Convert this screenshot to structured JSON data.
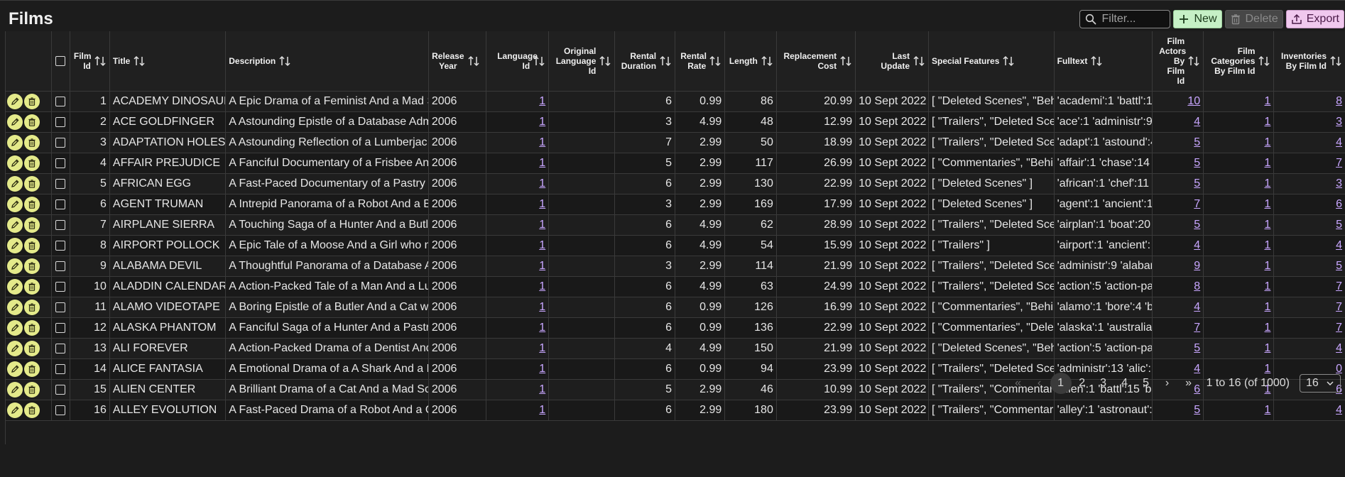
{
  "title": "Films",
  "toolbar": {
    "filter_placeholder": "Filter...",
    "new_label": "New",
    "delete_label": "Delete",
    "export_label": "Export"
  },
  "columns": [
    {
      "label": "Film Id"
    },
    {
      "label": "Title"
    },
    {
      "label": "Description"
    },
    {
      "label": "Release Year"
    },
    {
      "label": "Language Id"
    },
    {
      "label": "Original Language Id"
    },
    {
      "label": "Rental Duration"
    },
    {
      "label": "Rental Rate"
    },
    {
      "label": "Length"
    },
    {
      "label": "Replacement Cost"
    },
    {
      "label": "Last Update"
    },
    {
      "label": "Special Features"
    },
    {
      "label": "Fulltext"
    },
    {
      "label": "Film Actors By Film Id"
    },
    {
      "label": "Film Categories By Film Id"
    },
    {
      "label": "Inventories By Film Id"
    }
  ],
  "rows": [
    {
      "id": "1",
      "title": "ACADEMY DINOSAUR",
      "description": "A Epic Drama of a Feminist And a Mad S",
      "year": "2006",
      "lang": "1",
      "orig": "",
      "duration": "6",
      "rate": "0.99",
      "length": "86",
      "cost": "20.99",
      "updated": "10 Sept 2022",
      "features": "[ \"Deleted Scenes\", \"Behin",
      "fulltext": "'academi':1 'battl':1",
      "actors": "10",
      "categories": "1",
      "inventories": "8"
    },
    {
      "id": "2",
      "title": "ACE GOLDFINGER",
      "description": "A Astounding Epistle of a Database Adm",
      "year": "2006",
      "lang": "1",
      "orig": "",
      "duration": "3",
      "rate": "4.99",
      "length": "48",
      "cost": "12.99",
      "updated": "10 Sept 2022",
      "features": "[ \"Trailers\", \"Deleted Scen",
      "fulltext": "'ace':1 'administr':9",
      "actors": "4",
      "categories": "1",
      "inventories": "3"
    },
    {
      "id": "3",
      "title": "ADAPTATION HOLES",
      "description": "A Astounding Reflection of a Lumberjac",
      "year": "2006",
      "lang": "1",
      "orig": "",
      "duration": "7",
      "rate": "2.99",
      "length": "50",
      "cost": "18.99",
      "updated": "10 Sept 2022",
      "features": "[ \"Trailers\", \"Deleted Scen",
      "fulltext": "'adapt':1 'astound':4",
      "actors": "5",
      "categories": "1",
      "inventories": "4"
    },
    {
      "id": "4",
      "title": "AFFAIR PREJUDICE",
      "description": "A Fanciful Documentary of a Frisbee An",
      "year": "2006",
      "lang": "1",
      "orig": "",
      "duration": "5",
      "rate": "2.99",
      "length": "117",
      "cost": "26.99",
      "updated": "10 Sept 2022",
      "features": "[ \"Commentaries\", \"Behin",
      "fulltext": "'affair':1 'chase':14",
      "actors": "5",
      "categories": "1",
      "inventories": "7"
    },
    {
      "id": "5",
      "title": "AFRICAN EGG",
      "description": "A Fast-Paced Documentary of a Pastry C",
      "year": "2006",
      "lang": "1",
      "orig": "",
      "duration": "6",
      "rate": "2.99",
      "length": "130",
      "cost": "22.99",
      "updated": "10 Sept 2022",
      "features": "[ \"Deleted Scenes\" ]",
      "fulltext": "'african':1 'chef':11",
      "actors": "5",
      "categories": "1",
      "inventories": "3"
    },
    {
      "id": "6",
      "title": "AGENT TRUMAN",
      "description": "A Intrepid Panorama of a Robot And a B",
      "year": "2006",
      "lang": "1",
      "orig": "",
      "duration": "3",
      "rate": "2.99",
      "length": "169",
      "cost": "17.99",
      "updated": "10 Sept 2022",
      "features": "[ \"Deleted Scenes\" ]",
      "fulltext": "'agent':1 'ancient':1",
      "actors": "7",
      "categories": "1",
      "inventories": "6"
    },
    {
      "id": "7",
      "title": "AIRPLANE SIERRA",
      "description": "A Touching Saga of a Hunter And a Butl",
      "year": "2006",
      "lang": "1",
      "orig": "",
      "duration": "6",
      "rate": "4.99",
      "length": "62",
      "cost": "28.99",
      "updated": "10 Sept 2022",
      "features": "[ \"Trailers\", \"Deleted Scen",
      "fulltext": "'airplan':1 'boat':20",
      "actors": "5",
      "categories": "1",
      "inventories": "5"
    },
    {
      "id": "8",
      "title": "AIRPORT POLLOCK",
      "description": "A Epic Tale of a Moose And a Girl who n",
      "year": "2006",
      "lang": "1",
      "orig": "",
      "duration": "6",
      "rate": "4.99",
      "length": "54",
      "cost": "15.99",
      "updated": "10 Sept 2022",
      "features": "[ \"Trailers\" ]",
      "fulltext": "'airport':1 'ancient':",
      "actors": "4",
      "categories": "1",
      "inventories": "4"
    },
    {
      "id": "9",
      "title": "ALABAMA DEVIL",
      "description": "A Thoughtful Panorama of a Database A",
      "year": "2006",
      "lang": "1",
      "orig": "",
      "duration": "3",
      "rate": "2.99",
      "length": "114",
      "cost": "21.99",
      "updated": "10 Sept 2022",
      "features": "[ \"Trailers\", \"Deleted Scen",
      "fulltext": "'administr':9 'alabar",
      "actors": "9",
      "categories": "1",
      "inventories": "5"
    },
    {
      "id": "10",
      "title": "ALADDIN CALENDAR",
      "description": "A Action-Packed Tale of a Man And a Lu",
      "year": "2006",
      "lang": "1",
      "orig": "",
      "duration": "6",
      "rate": "4.99",
      "length": "63",
      "cost": "24.99",
      "updated": "10 Sept 2022",
      "features": "[ \"Trailers\", \"Deleted Scen",
      "fulltext": "'action':5 'action-pa",
      "actors": "8",
      "categories": "1",
      "inventories": "7"
    },
    {
      "id": "11",
      "title": "ALAMO VIDEOTAPE",
      "description": "A Boring Epistle of a Butler And a Cat wl",
      "year": "2006",
      "lang": "1",
      "orig": "",
      "duration": "6",
      "rate": "0.99",
      "length": "126",
      "cost": "16.99",
      "updated": "10 Sept 2022",
      "features": "[ \"Commentaries\", \"Behin",
      "fulltext": "'alamo':1 'bore':4 'bu",
      "actors": "4",
      "categories": "1",
      "inventories": "7"
    },
    {
      "id": "12",
      "title": "ALASKA PHANTOM",
      "description": "A Fanciful Saga of a Hunter And a Pastr",
      "year": "2006",
      "lang": "1",
      "orig": "",
      "duration": "6",
      "rate": "0.99",
      "length": "136",
      "cost": "22.99",
      "updated": "10 Sept 2022",
      "features": "[ \"Commentaries\", \"Delete",
      "fulltext": "'alaska':1 'australia'",
      "actors": "7",
      "categories": "1",
      "inventories": "7"
    },
    {
      "id": "13",
      "title": "ALI FOREVER",
      "description": "A Action-Packed Drama of a Dentist And",
      "year": "2006",
      "lang": "1",
      "orig": "",
      "duration": "4",
      "rate": "4.99",
      "length": "150",
      "cost": "21.99",
      "updated": "10 Sept 2022",
      "features": "[ \"Deleted Scenes\", \"Behir",
      "fulltext": "'action':5 'action-pa",
      "actors": "5",
      "categories": "1",
      "inventories": "4"
    },
    {
      "id": "14",
      "title": "ALICE FANTASIA",
      "description": "A Emotional Drama of a A Shark And a D",
      "year": "2006",
      "lang": "1",
      "orig": "",
      "duration": "6",
      "rate": "0.99",
      "length": "94",
      "cost": "23.99",
      "updated": "10 Sept 2022",
      "features": "[ \"Trailers\", \"Deleted Scen",
      "fulltext": "'administr':13 'alic':",
      "actors": "4",
      "categories": "1",
      "inventories": "0"
    },
    {
      "id": "15",
      "title": "ALIEN CENTER",
      "description": "A Brilliant Drama of a Cat And a Mad Sc",
      "year": "2006",
      "lang": "1",
      "orig": "",
      "duration": "5",
      "rate": "2.99",
      "length": "46",
      "cost": "10.99",
      "updated": "10 Sept 2022",
      "features": "[ \"Trailers\", \"Commentarie",
      "fulltext": "'alien':1 'battl':15 'br",
      "actors": "6",
      "categories": "1",
      "inventories": "6"
    },
    {
      "id": "16",
      "title": "ALLEY EVOLUTION",
      "description": "A Fast-Paced Drama of a Robot And a C",
      "year": "2006",
      "lang": "1",
      "orig": "",
      "duration": "6",
      "rate": "2.99",
      "length": "180",
      "cost": "23.99",
      "updated": "10 Sept 2022",
      "features": "[ \"Trailers\", \"Commentarie",
      "fulltext": "'alley':1 'astronaut':",
      "actors": "5",
      "categories": "1",
      "inventories": "4"
    }
  ],
  "pagination": {
    "pages": [
      "1",
      "2",
      "3",
      "4",
      "5"
    ],
    "current": "1",
    "range_text": "1 to 16 (of 1000)",
    "page_size": "16"
  },
  "colors": {
    "background": "#1c1c1c",
    "new_button": "#c6f0c6",
    "export_button": "#f0c8ee",
    "action_button": "#e4ea8a",
    "link": "#c8a6ff"
  },
  "icons": [
    "search-icon",
    "plus-icon",
    "trash-icon",
    "export-icon",
    "pencil-icon",
    "sort-icon",
    "chevron-down-icon"
  ]
}
